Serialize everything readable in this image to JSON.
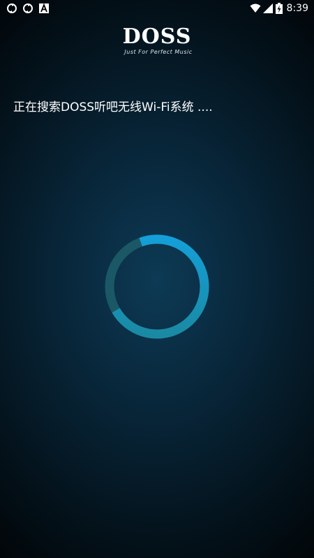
{
  "status_bar": {
    "time": "8:39",
    "icons": [
      "sync-icon",
      "sync-icon",
      "font-icon",
      "wifi-icon",
      "signal-icon",
      "battery-charging-icon"
    ]
  },
  "logo": {
    "text": "DOSS",
    "tagline": "Just For Perfect Music"
  },
  "main": {
    "status_text": "正在搜索DOSS听吧无线Wi-Fi系统 ...."
  },
  "colors": {
    "background_center": "#0d3a55",
    "background_edge": "#000000",
    "spinner_active": "#139ed6",
    "spinner_track": "#1b6b7a"
  }
}
